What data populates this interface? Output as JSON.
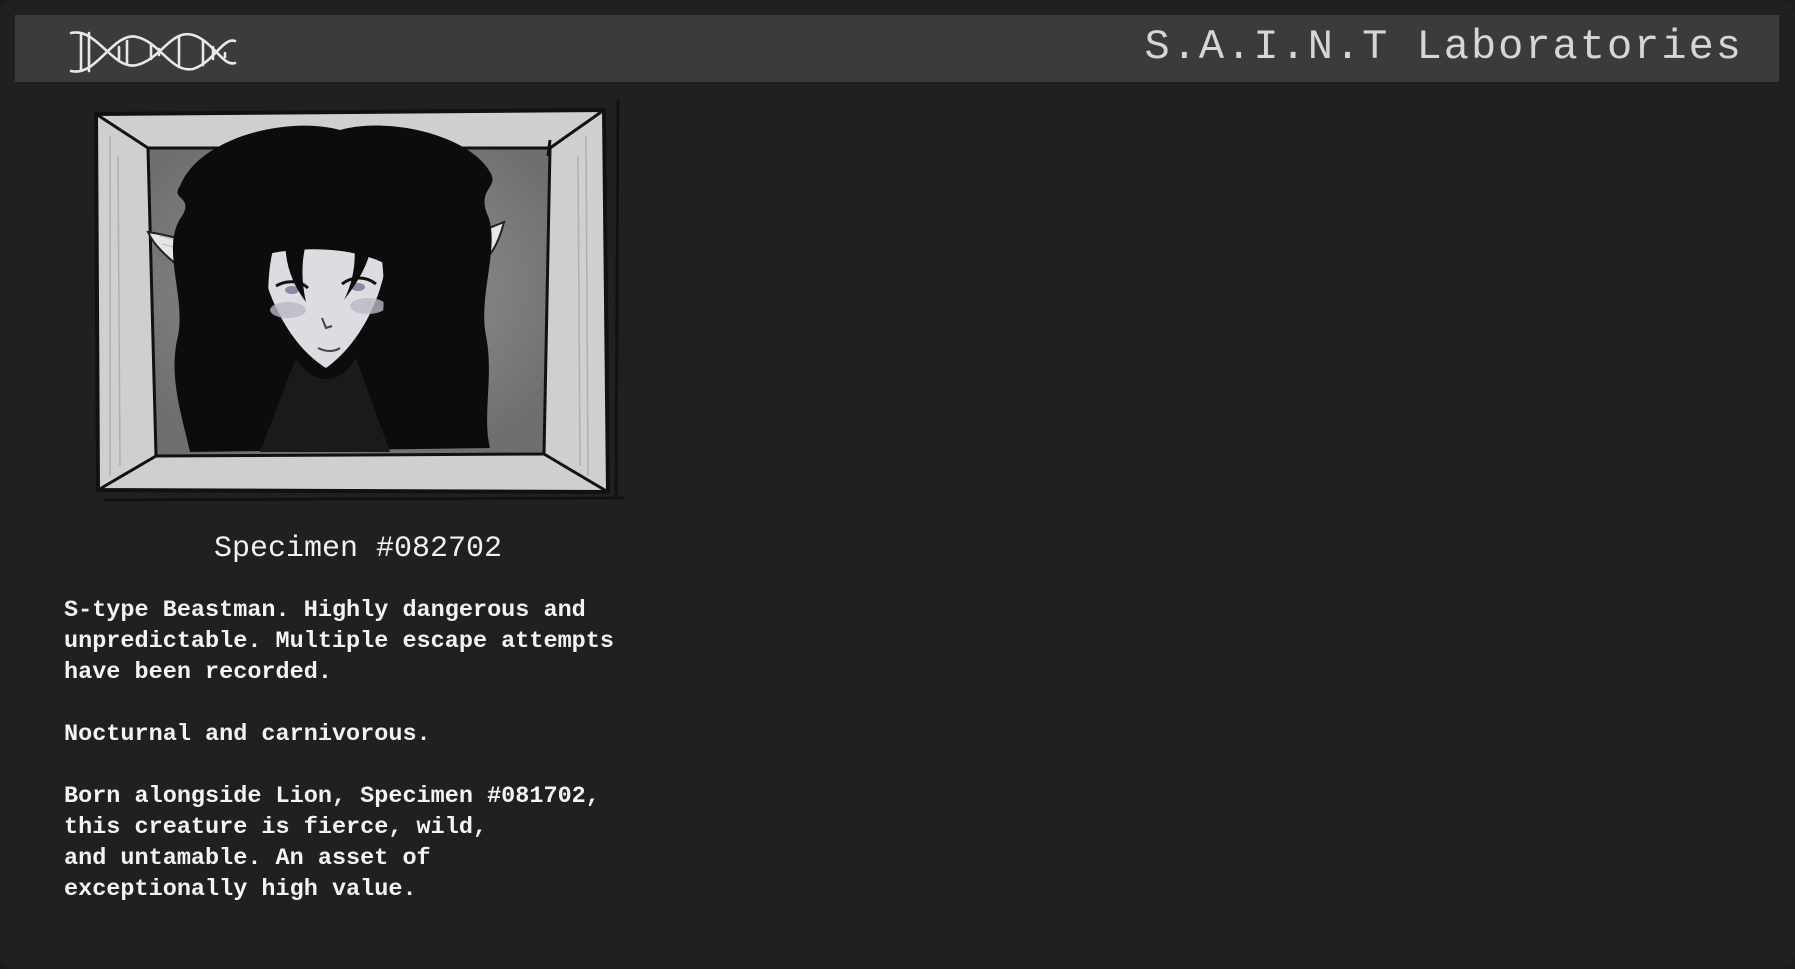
{
  "header": {
    "brand": "S.A.I.N.T Laboratories",
    "logo_icon": "dna-helix-icon"
  },
  "specimen": {
    "title": "Specimen #082702",
    "portrait_icon": "specimen-portrait-drawing",
    "description_lines": [
      "S-type Beastman. Highly dangerous and",
      "unpredictable. Multiple escape attempts",
      "have been recorded.",
      "",
      "Nocturnal and carnivorous.",
      "",
      "Born alongside Lion, Specimen #081702,",
      "this creature is fierce, wild,",
      "and untamable. An asset of",
      "exceptionally high value."
    ]
  },
  "colors": {
    "background": "#202020",
    "header": "#3b3b3b",
    "text": "#f4f4f4"
  }
}
